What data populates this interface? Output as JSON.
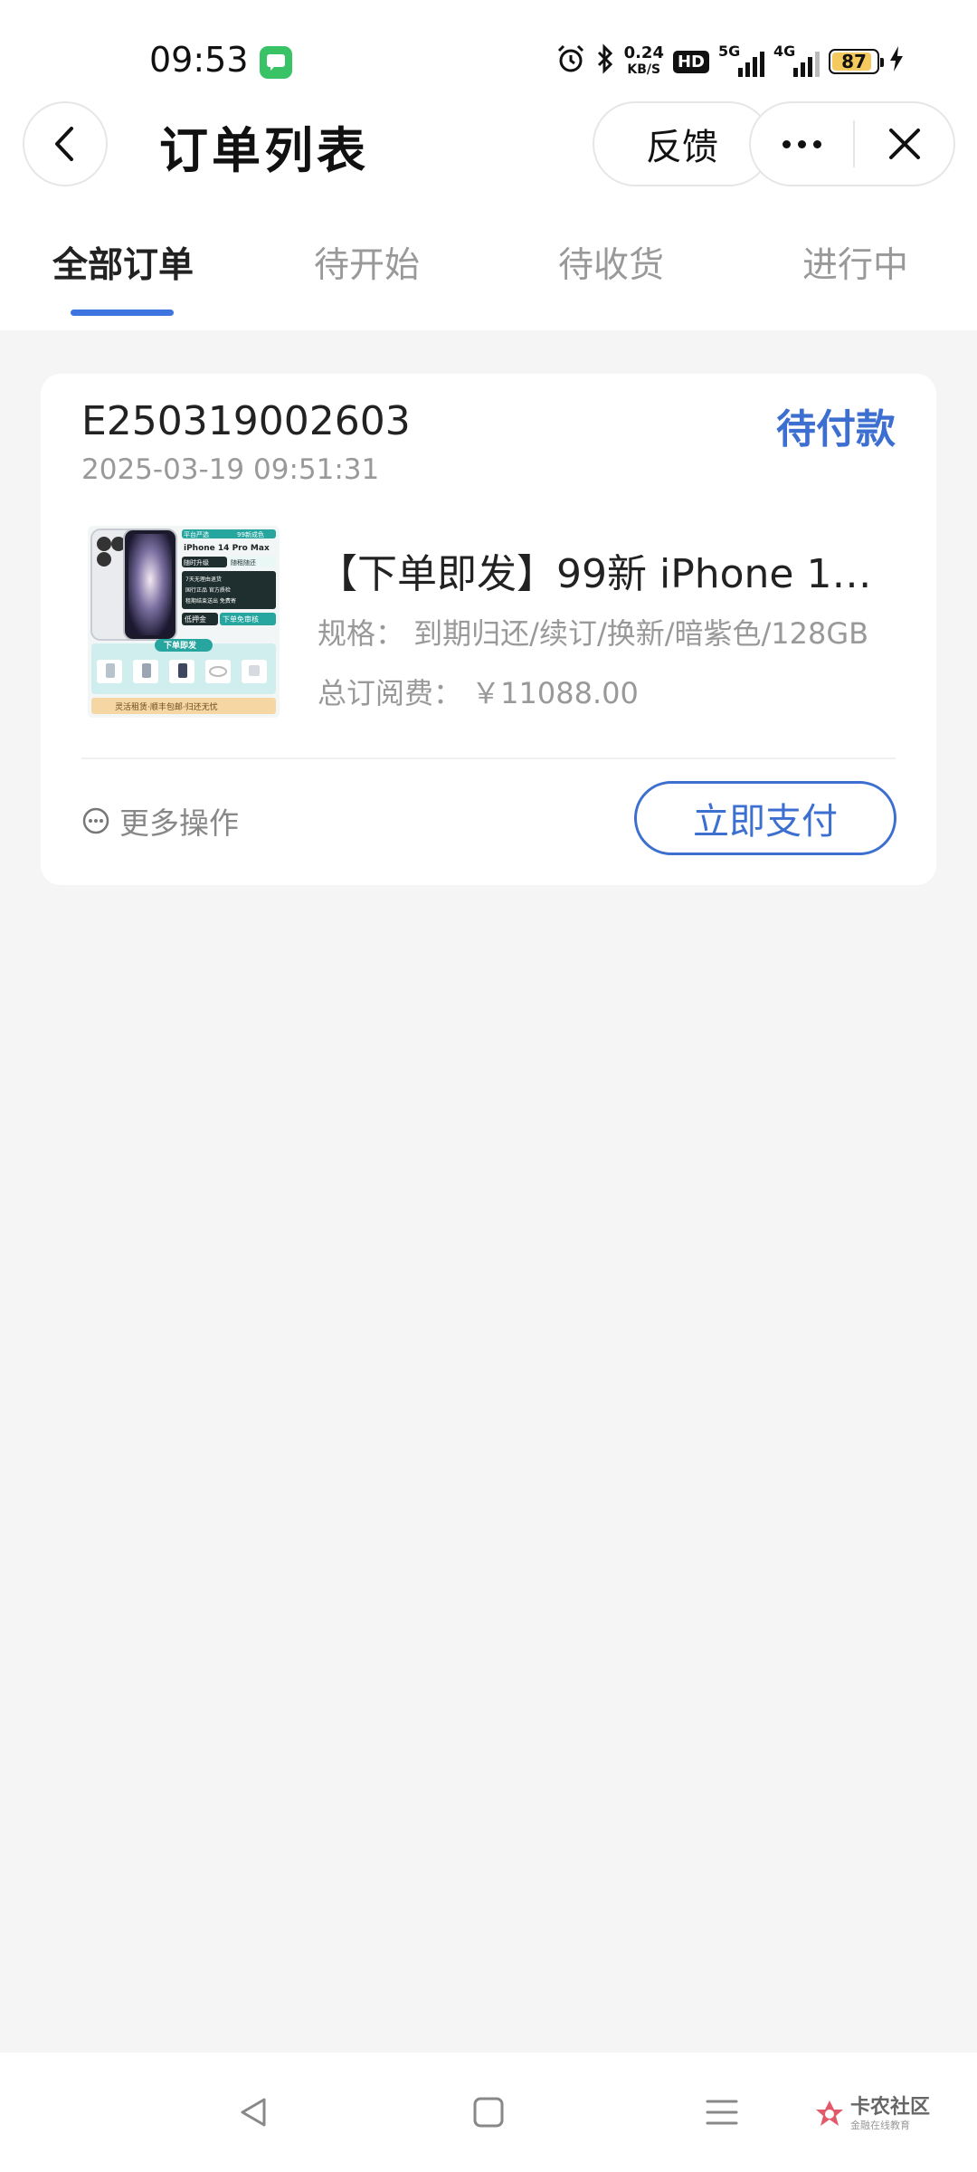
{
  "status_bar": {
    "time": "09:53",
    "speed_value": "0.24",
    "speed_unit": "KB/S",
    "hd": "HD",
    "net1": "5G",
    "net2": "4G",
    "battery": "87"
  },
  "nav": {
    "title": "订单列表",
    "feedback_label": "反馈"
  },
  "tabs": [
    {
      "label": "全部订单",
      "active": true
    },
    {
      "label": "待开始",
      "active": false
    },
    {
      "label": "待收货",
      "active": false
    },
    {
      "label": "进行中",
      "active": false
    }
  ],
  "order": {
    "order_no": "E250319002603",
    "time": "2025-03-19 09:51:31",
    "status": "待付款",
    "product": {
      "title": "【下单即发】99新 iPhone 14 …",
      "spec": "规格：  到期归还/续订/换新/暗紫色/128GB",
      "fee": "总订阅费：  ￥11088.00",
      "image_text": {
        "badge1": "平台严选",
        "badge2": "99新成色",
        "model": "iPhone 14 Pro Max",
        "tag1": "随时升级",
        "tag2": "随租随还",
        "feat1": "7天无理由退货",
        "feat2": "国行正品 官方质检",
        "feat3": "租期结束送出 免费寄",
        "deposit": "低押金",
        "no_review": "下单免审核",
        "ship": "下单即发",
        "footer": "灵活租赁·顺丰包邮·归还无忧"
      }
    },
    "more_actions": "更多操作",
    "pay_button": "立即支付"
  },
  "watermark": {
    "main": "卡农社区",
    "sub": "金融在线教育"
  },
  "colors": {
    "accent": "#3d6fd0",
    "tab_indicator": "#3d74e0",
    "background": "#f5f5f5"
  }
}
